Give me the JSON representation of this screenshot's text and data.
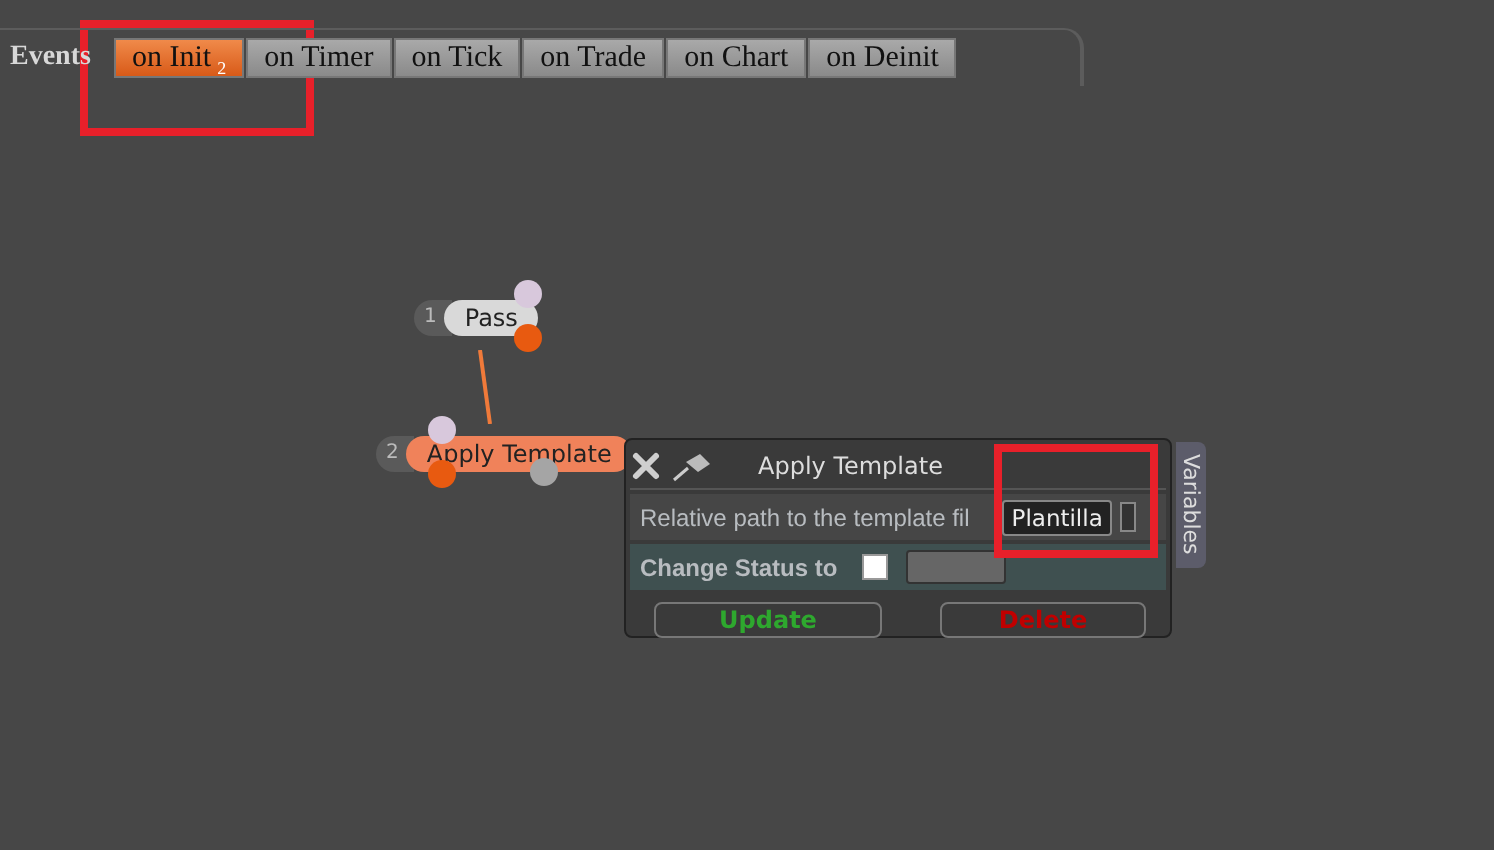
{
  "events_bar": {
    "label": "Events",
    "tabs": [
      {
        "label": "on Init",
        "badge": "2",
        "selected": true
      },
      {
        "label": "on Timer",
        "selected": false
      },
      {
        "label": "on Tick",
        "selected": false
      },
      {
        "label": "on Trade",
        "selected": false
      },
      {
        "label": "on Chart",
        "selected": false
      },
      {
        "label": "on Deinit",
        "selected": false
      }
    ]
  },
  "nodes": [
    {
      "number": "1",
      "label": "Pass",
      "selected": false
    },
    {
      "number": "2",
      "label": "Apply Template",
      "selected": true
    }
  ],
  "dialog": {
    "title": "Apply Template",
    "fields": [
      {
        "kind": "text",
        "label": "Relative path to the template fil",
        "value": "Plantilla"
      },
      {
        "kind": "checkbox",
        "label": "Change Status to",
        "checked": false
      }
    ],
    "buttons": [
      {
        "kind": "update",
        "label": "Update"
      },
      {
        "kind": "delete",
        "label": "Delete"
      }
    ],
    "side_tab": "Variables"
  }
}
